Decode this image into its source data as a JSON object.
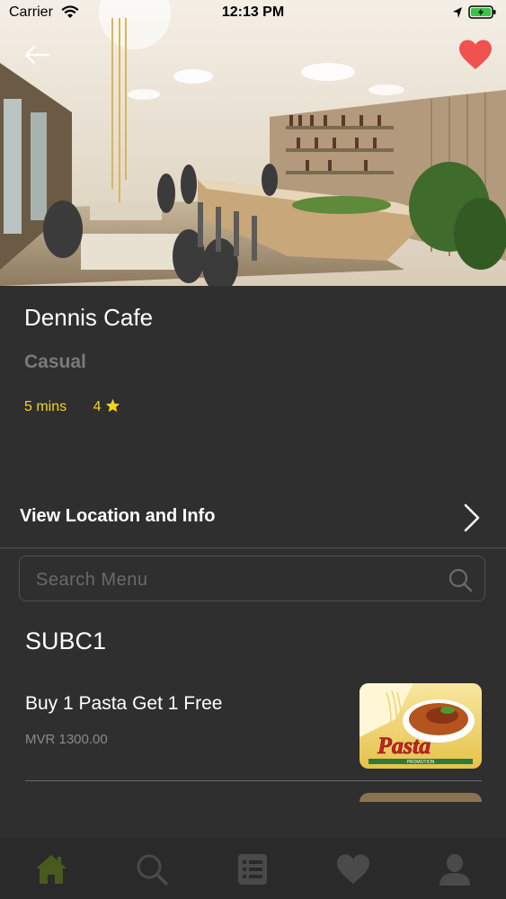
{
  "status_bar": {
    "carrier": "Carrier",
    "time": "12:13 PM"
  },
  "hero": {
    "back_icon": "arrow-left-icon",
    "favorite_icon": "heart-icon",
    "favorite_color": "#f0524f"
  },
  "restaurant": {
    "name": "Dennis Cafe",
    "category": "Casual",
    "delivery_time": "5 mins",
    "rating": "4",
    "rating_icon": "star-icon",
    "accent_color": "#f2d51e"
  },
  "location_row": {
    "label": "View Location and Info",
    "icon": "chevron-right-icon"
  },
  "search": {
    "placeholder": "Search Menu",
    "value": "",
    "icon": "search-icon"
  },
  "menu": {
    "section_title": "SUBC1",
    "items": [
      {
        "title": "Buy 1 Pasta Get 1 Free",
        "price": "MVR 1300.00",
        "image_text": "Pasta",
        "image_subtext": "PROMOTION"
      }
    ]
  },
  "tabs": [
    {
      "name": "home",
      "icon": "home-icon",
      "active": true
    },
    {
      "name": "search",
      "icon": "search-icon",
      "active": false
    },
    {
      "name": "list",
      "icon": "list-icon",
      "active": false
    },
    {
      "name": "favorites",
      "icon": "heart-icon",
      "active": false
    },
    {
      "name": "profile",
      "icon": "user-icon",
      "active": false
    }
  ],
  "colors": {
    "background": "#2f2f2f",
    "active_tab": "#4a5a1e",
    "inactive_tab": "#4a4a4a"
  }
}
